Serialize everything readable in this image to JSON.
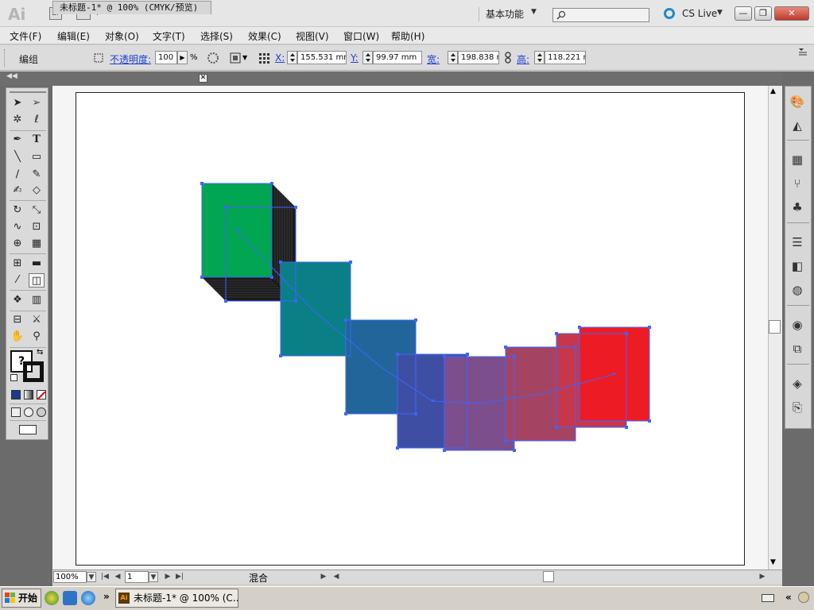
{
  "app": {
    "logo_text": "Ai",
    "bridge_label": "Br",
    "workspace_label": "基本功能",
    "cs_live_label": "CS Live",
    "window_buttons": [
      "—",
      "❐",
      "✕"
    ]
  },
  "menu": {
    "items": [
      "文件(F)",
      "编辑(E)",
      "对象(O)",
      "文字(T)",
      "选择(S)",
      "效果(C)",
      "视图(V)",
      "窗口(W)",
      "帮助(H)"
    ]
  },
  "control_bar": {
    "selection_label": "编组",
    "opacity_label": "不透明度:",
    "opacity_value": "100",
    "opacity_unit": "%",
    "x_label": "X:",
    "x_value": "155.531 mm",
    "y_label": "Y:",
    "y_value": "99.97 mm",
    "width_label": "宽:",
    "width_value": "198.838 mı",
    "height_label": "高:",
    "height_value": "118.221 mı"
  },
  "document": {
    "tab_title": "未标题-1* @ 100% (CMYK/预览)",
    "tab_close": "✕"
  },
  "status_bar": {
    "zoom_value": "100%",
    "page_value": "1",
    "tool_status": "混合"
  },
  "taskbar": {
    "start_label": "开始",
    "task_doc_label": "未标题-1* @ 100% (C...",
    "task_app_icon": "Ai",
    "chevron": "»"
  },
  "artwork": {
    "colors": {
      "green": "#00a651",
      "teal": "#0a7f85",
      "steel_blue": "#22659a",
      "indigo": "#3e4fa3",
      "purple": "#7c4e8c",
      "mauve": "#a44462",
      "crimson": "#c6374c",
      "red": "#ed1c24",
      "selection": "#3e64ff"
    }
  },
  "icons": {
    "tools": [
      "selection-icon",
      "direct-selection-icon",
      "magic-wand-icon",
      "lasso-icon",
      "pen-icon",
      "type-icon",
      "line-icon",
      "rectangle-icon",
      "paintbrush-icon",
      "pencil-icon",
      "blob-brush-icon",
      "eraser-icon",
      "rotate-icon",
      "scale-icon",
      "warp-icon",
      "free-transform-icon",
      "shape-builder-icon",
      "perspective-grid-icon",
      "mesh-icon",
      "gradient-icon",
      "eyedropper-icon",
      "blend-icon",
      "symbol-sprayer-icon",
      "column-graph-icon",
      "artboard-icon",
      "slice-icon",
      "hand-icon",
      "zoom-icon"
    ],
    "right_panel": [
      "color-icon",
      "color-guide-icon",
      "swatches-icon",
      "brushes-icon",
      "symbols-icon",
      "stroke-icon",
      "gradient-panel-icon",
      "transparency-icon",
      "appearance-icon",
      "graphic-styles-icon",
      "layers-icon",
      "artboards-icon"
    ]
  }
}
